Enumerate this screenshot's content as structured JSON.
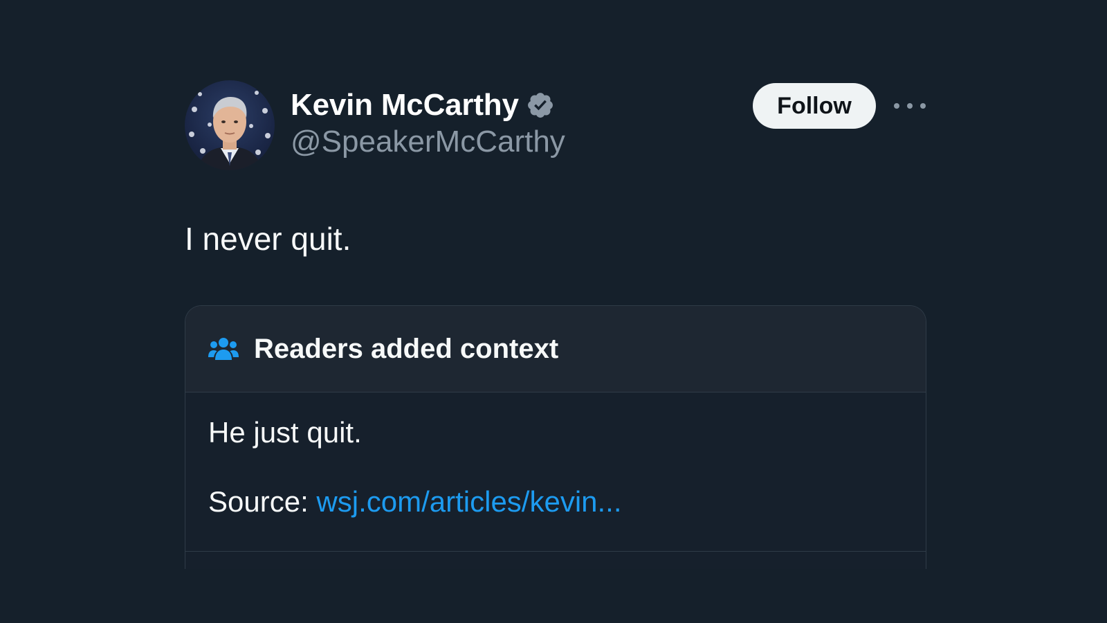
{
  "tweet": {
    "author": {
      "display_name": "Kevin McCarthy",
      "handle": "@SpeakerMcCarthy",
      "verified": true
    },
    "follow_label": "Follow",
    "text": "I never quit."
  },
  "community_note": {
    "title": "Readers added context",
    "body": "He just quit.",
    "source_label": "Source:",
    "source_link": "wsj.com/articles/kevin..."
  },
  "colors": {
    "background": "#15202b",
    "link": "#1d9bf0",
    "secondary_text": "#8b98a5",
    "verified_badge": "#8b98a5",
    "readers_icon": "#1d9bf0"
  },
  "icons": {
    "verified": "verified-badge-icon",
    "more": "more-options-icon",
    "readers": "readers-group-icon"
  }
}
